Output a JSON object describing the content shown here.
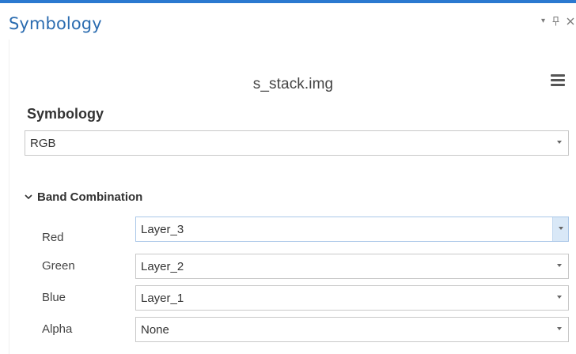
{
  "pane": {
    "title": "Symbology",
    "controls": {
      "dropdown_icon": "chevron-down-icon",
      "pin_icon": "pin-icon",
      "close_icon": "close-icon"
    }
  },
  "layer": {
    "name": "s_stack.img",
    "menu_icon": "hamburger-menu-icon"
  },
  "symbology": {
    "section_title": "Symbology",
    "renderer_value": "RGB"
  },
  "band_combination": {
    "header": "Band Combination",
    "expanded": true,
    "bands": [
      {
        "label": "Red",
        "value": "Layer_3",
        "active": true
      },
      {
        "label": "Green",
        "value": "Layer_2",
        "active": false
      },
      {
        "label": "Blue",
        "value": "Layer_1",
        "active": false
      },
      {
        "label": "Alpha",
        "value": "None",
        "active": false
      }
    ]
  },
  "colors": {
    "accent": "#2b79d0",
    "title": "#2b6cb0"
  }
}
